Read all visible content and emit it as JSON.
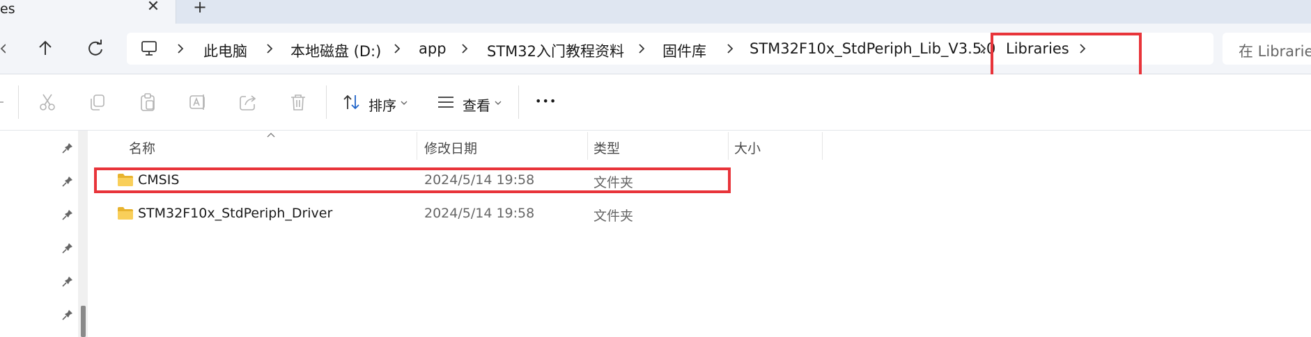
{
  "tab": {
    "title": "es",
    "close_glyph": "✕",
    "new_tab_glyph": "+"
  },
  "breadcrumbs": [
    "此电脑",
    "本地磁盘 (D:)",
    "app",
    "STM32入门教程资料",
    "固件库",
    "STM32F10x_StdPeriph_Lib_V3.5.0",
    "Libraries"
  ],
  "search": {
    "placeholder": "在 Libraries"
  },
  "toolbar": {
    "sort_label": "排序",
    "view_label": "查看",
    "more_glyph": "•••"
  },
  "columns": [
    "名称",
    "修改日期",
    "类型",
    "大小"
  ],
  "files": [
    {
      "name": "CMSIS",
      "modified": "2024/5/14 19:58",
      "type": "文件夹",
      "size": ""
    },
    {
      "name": "STM32F10x_StdPeriph_Driver",
      "modified": "2024/5/14 19:58",
      "type": "文件夹",
      "size": ""
    }
  ],
  "colors": {
    "highlight": "#e8343a",
    "folder": "#f5c342",
    "chrome": "#f3f5f9"
  },
  "icons": [
    "back-icon",
    "up-arrow-icon",
    "refresh-icon",
    "computer-icon",
    "cut-icon",
    "copy-icon",
    "paste-icon",
    "rename-icon",
    "share-icon",
    "delete-icon",
    "sort-icon",
    "view-icon",
    "more-icon",
    "pin-icon",
    "folder-icon"
  ]
}
